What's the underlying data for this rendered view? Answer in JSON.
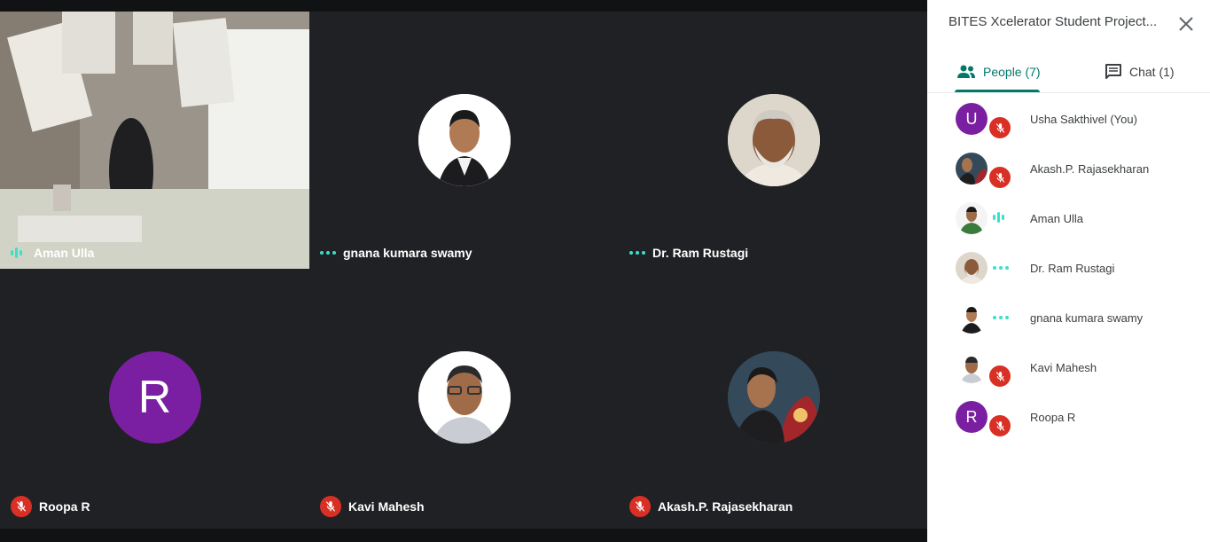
{
  "participants_grid": [
    {
      "name": "Aman Ulla",
      "status": "speaking",
      "has_video": true
    },
    {
      "name": "gnana kumara swamy",
      "status": "connecting"
    },
    {
      "name": "Dr. Ram Rustagi",
      "status": "connecting"
    },
    {
      "name": "Roopa R",
      "status": "muted",
      "initial": "R"
    },
    {
      "name": "Kavi Mahesh",
      "status": "muted"
    },
    {
      "name": "Akash.P. Rajasekharan",
      "status": "muted"
    }
  ],
  "panel": {
    "title": "BITES Xcelerator Student Project...",
    "close_icon": "close-icon",
    "tabs": [
      {
        "label": "People (7)",
        "icon": "people-icon",
        "active": true
      },
      {
        "label": "Chat (1)",
        "icon": "chat-icon",
        "active": false
      }
    ],
    "people": [
      {
        "name": "Usha Sakthivel (You)",
        "initial": "U",
        "status": "muted"
      },
      {
        "name": "Akash.P. Rajasekharan",
        "status": "muted"
      },
      {
        "name": "Aman Ulla",
        "status": "speaking"
      },
      {
        "name": "Dr. Ram Rustagi",
        "status": "connecting"
      },
      {
        "name": "gnana kumara swamy",
        "status": "connecting"
      },
      {
        "name": "Kavi Mahesh",
        "status": "muted"
      },
      {
        "name": "Roopa R",
        "initial": "R",
        "status": "muted"
      }
    ]
  },
  "colors": {
    "accent": "#00796b",
    "muted": "#d93025",
    "speaking": "#3be0c9",
    "avatar_purple": "#7b1fa2"
  }
}
